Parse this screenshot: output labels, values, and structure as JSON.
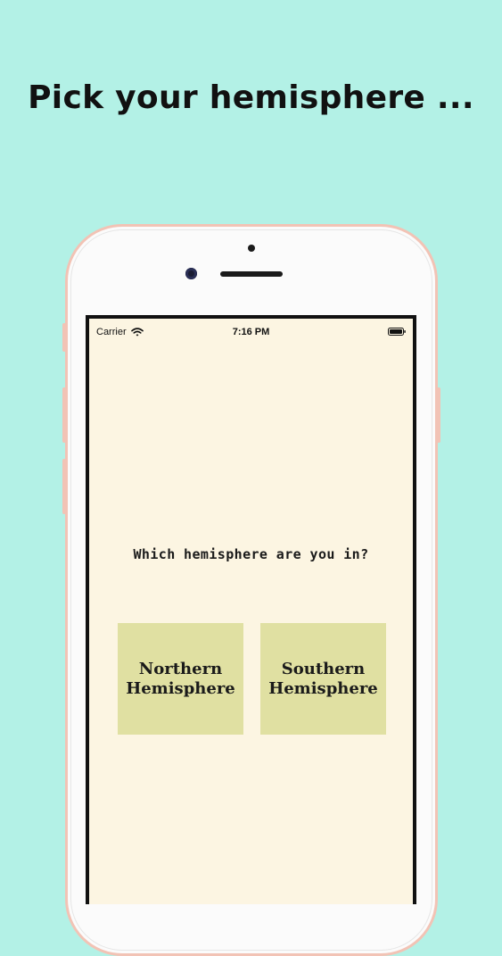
{
  "headline": "Pick your hemisphere ...",
  "status_bar": {
    "carrier": "Carrier",
    "time": "7:16 PM",
    "icons": [
      "wifi-icon",
      "battery-icon"
    ]
  },
  "app": {
    "question": "Which hemisphere are you in?",
    "options": [
      {
        "label": "Northern\nHemisphere"
      },
      {
        "label": "Southern\nHemisphere"
      }
    ]
  },
  "colors": {
    "page_background": "#b3f1e6",
    "screen_background": "#fcf5e2",
    "button_background": "#e0e0a2",
    "phone_frame": "#f2c3b5",
    "text": "#111111"
  }
}
